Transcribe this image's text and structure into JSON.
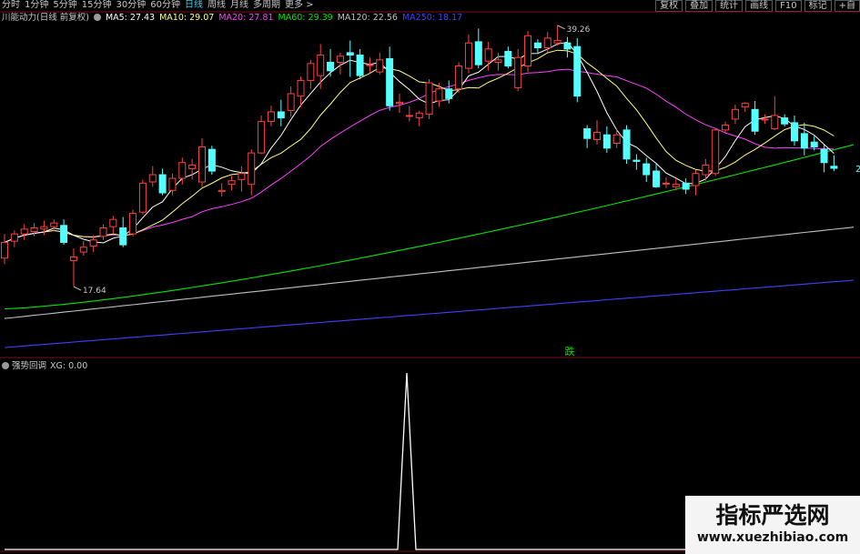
{
  "toolbar": {
    "periods": [
      "分时",
      "1分钟",
      "5分钟",
      "15分钟",
      "30分钟",
      "60分钟",
      "日线",
      "周线",
      "月线",
      "多周期",
      "更多 >"
    ],
    "active_period": "日线",
    "buttons": [
      "复权",
      "叠加",
      "统计",
      "画线",
      "F10",
      "标记",
      "+自"
    ]
  },
  "legend": {
    "title": "川能动力(日线 前复权)",
    "ma5": "MA5: 27.43",
    "ma10": "MA10: 29.07",
    "ma20": "MA20: 27.81",
    "ma60": "MA60: 29.39",
    "ma120": "MA120: 22.56",
    "ma250": "MA250: 18.17"
  },
  "colors": {
    "up": "#ff4040",
    "down": "#54ffff",
    "ma5": "#ffffff",
    "ma10": "#ffff80",
    "ma20": "#ff40ff",
    "ma60": "#00e600",
    "ma120": "#c0c0c0",
    "ma250": "#4040ff",
    "indicator": "#ffffff",
    "bg": "#000000"
  },
  "indicator": {
    "title": "强势回调",
    "value": "XG: 0.00"
  },
  "chart_data": {
    "type": "candlestick",
    "ylim": [
      12,
      40
    ],
    "y_indicator_range": [
      0,
      1
    ],
    "annotations": {
      "high_label": "39.26",
      "low_label": "17.64",
      "signal_text": "跌",
      "right_edge_mark": "2"
    },
    "candles": [
      [
        20,
        22,
        19.5,
        21.3
      ],
      [
        21.4,
        22.3,
        20.9,
        22.0
      ],
      [
        22.0,
        22.8,
        21.5,
        22.4
      ],
      [
        22.2,
        22.9,
        21.8,
        22.5
      ],
      [
        22.4,
        23.1,
        21.9,
        22.6
      ],
      [
        22.6,
        23.2,
        22.2,
        22.9
      ],
      [
        22.7,
        23.2,
        21.1,
        21.3
      ],
      [
        19.8,
        20.8,
        17.64,
        20.1
      ],
      [
        20.5,
        21.4,
        20.2,
        20.9
      ],
      [
        21.0,
        21.9,
        20.5,
        21.5
      ],
      [
        21.8,
        22.8,
        21.5,
        22.5
      ],
      [
        22.6,
        23.5,
        22.0,
        23.2
      ],
      [
        22.5,
        23.4,
        20.9,
        21.1
      ],
      [
        22.0,
        24.0,
        21.8,
        23.7
      ],
      [
        23.8,
        26.5,
        23.6,
        26.2
      ],
      [
        26.3,
        27.6,
        25.9,
        26.9
      ],
      [
        26.9,
        27.4,
        25.2,
        25.4
      ],
      [
        25.6,
        27.0,
        25.2,
        26.6
      ],
      [
        26.6,
        28.3,
        26.1,
        27.9
      ],
      [
        27.4,
        28.2,
        26.5,
        27.7
      ],
      [
        26.3,
        29.9,
        25.9,
        29.2
      ],
      [
        29.0,
        29.3,
        26.9,
        27.2
      ],
      [
        25.5,
        26.2,
        25.1,
        25.6
      ],
      [
        26.1,
        26.8,
        25.6,
        26.4
      ],
      [
        26.5,
        27.6,
        25.5,
        27.0
      ],
      [
        26.1,
        29.0,
        25.2,
        28.7
      ],
      [
        28.7,
        31.8,
        28.6,
        31.3
      ],
      [
        31.3,
        32.6,
        30.9,
        32.1
      ],
      [
        32.1,
        33.1,
        30.9,
        31.6
      ],
      [
        32.2,
        34.2,
        31.7,
        33.6
      ],
      [
        33.4,
        35.0,
        32.5,
        34.7
      ],
      [
        34.7,
        36.4,
        34.0,
        36.1
      ],
      [
        35.1,
        37.7,
        34.0,
        36.8
      ],
      [
        36.2,
        37.3,
        35.0,
        35.5
      ],
      [
        36.2,
        37.0,
        35.2,
        36.7
      ],
      [
        37.0,
        38.0,
        35.0,
        36.8
      ],
      [
        36.8,
        37.3,
        34.8,
        35.1
      ],
      [
        36.0,
        36.6,
        35.3,
        36.0
      ],
      [
        35.4,
        37.0,
        35.2,
        36.4
      ],
      [
        36.5,
        37.5,
        32.2,
        32.6
      ],
      [
        32.8,
        33.6,
        32.0,
        32.9
      ],
      [
        31.8,
        32.6,
        31.3,
        31.8
      ],
      [
        31.6,
        32.2,
        30.9,
        32.0
      ],
      [
        31.9,
        34.8,
        31.5,
        34.5
      ],
      [
        33.0,
        34.5,
        32.5,
        34.0
      ],
      [
        34.0,
        34.7,
        32.8,
        33.2
      ],
      [
        34.0,
        36.2,
        33.7,
        35.9
      ],
      [
        35.7,
        38.5,
        35.3,
        37.8
      ],
      [
        37.9,
        39.0,
        35.7,
        36.0
      ],
      [
        36.3,
        37.9,
        35.5,
        37.3
      ],
      [
        36.2,
        37.0,
        35.5,
        36.4
      ],
      [
        37.1,
        37.5,
        35.7,
        35.9
      ],
      [
        34.1,
        37.3,
        33.8,
        36.6
      ],
      [
        35.9,
        38.8,
        35.4,
        38.4
      ],
      [
        37.8,
        38.1,
        37.0,
        37.4
      ],
      [
        37.4,
        38.7,
        37.0,
        38.2
      ],
      [
        37.8,
        39.26,
        37.6,
        38.0
      ],
      [
        37.8,
        38.3,
        36.6,
        37.3
      ],
      [
        37.5,
        38.2,
        32.9,
        33.4
      ],
      [
        30.7,
        31.0,
        29.1,
        29.9
      ],
      [
        29.8,
        31.4,
        29.4,
        30.4
      ],
      [
        30.2,
        30.9,
        28.7,
        29.1
      ],
      [
        29.5,
        30.7,
        29.1,
        30.2
      ],
      [
        30.6,
        31.0,
        27.8,
        28.2
      ],
      [
        28.1,
        28.6,
        27.3,
        28.0
      ],
      [
        27.8,
        28.3,
        26.3,
        26.9
      ],
      [
        27.2,
        27.8,
        25.8,
        25.9
      ],
      [
        26.2,
        26.7,
        25.8,
        26.2
      ],
      [
        25.9,
        26.6,
        25.6,
        26.1
      ],
      [
        26.2,
        26.6,
        25.3,
        25.7
      ],
      [
        26.0,
        27.3,
        25.2,
        27.0
      ],
      [
        26.9,
        28.2,
        26.4,
        27.7
      ],
      [
        27.0,
        30.7,
        26.8,
        30.6
      ],
      [
        30.6,
        31.3,
        30.4,
        31.0
      ],
      [
        31.5,
        32.7,
        31.1,
        32.3
      ],
      [
        32.5,
        32.9,
        32.1,
        32.8
      ],
      [
        32.3,
        33.0,
        30.2,
        30.5
      ],
      [
        31.5,
        31.9,
        31.1,
        31.5
      ],
      [
        30.7,
        33.4,
        30.6,
        31.8
      ],
      [
        31.6,
        31.9,
        30.9,
        31.1
      ],
      [
        31.2,
        31.8,
        29.3,
        29.7
      ],
      [
        30.3,
        31.2,
        28.5,
        29.1
      ],
      [
        29.6,
        30.1,
        28.9,
        29.2
      ],
      [
        29.0,
        29.4,
        27.1,
        27.9
      ],
      [
        27.6,
        28.5,
        27.2,
        27.43
      ]
    ],
    "ma250_range": [
      12.6,
      18.17
    ],
    "ma120_range": [
      15.0,
      22.56
    ],
    "ma60_range": [
      15.8,
      29.39
    ],
    "indicator_signal_index": 40
  }
}
